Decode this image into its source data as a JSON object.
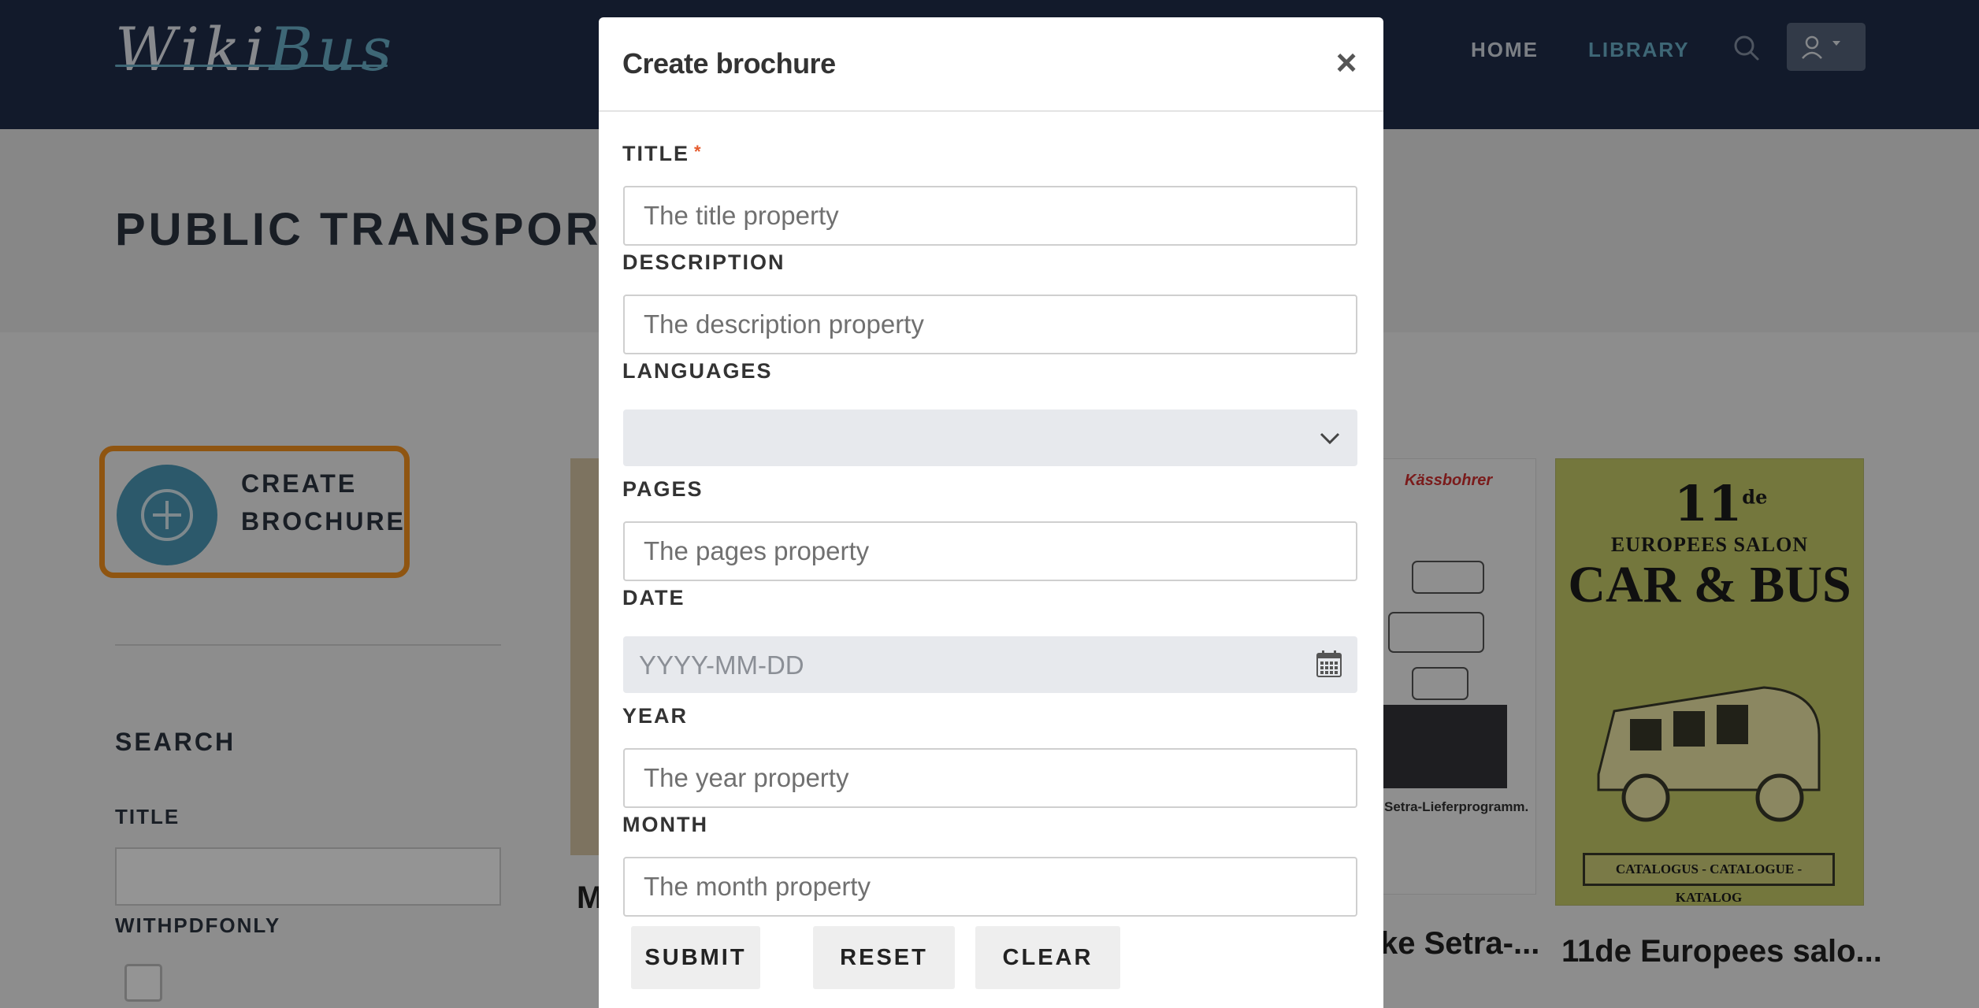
{
  "app": {
    "logo_wiki": "Wiki",
    "logo_bus": "Bus",
    "nav": {
      "home": "HOME",
      "library": "LIBRARY"
    },
    "icons": {
      "search": "search-icon",
      "user": "user-icon",
      "caret": "caret-down-icon"
    }
  },
  "page": {
    "title": "PUBLIC TRANSPORT B",
    "create_button": {
      "line1": "CREATE",
      "line2": "BROCHURE"
    },
    "sidebar": {
      "search_heading": "SEARCH",
      "title_label": "TITLE",
      "title_value": "",
      "withpdfonly_label": "WITHPDFONLY",
      "withpdfonly_checked": false
    },
    "cards": [
      {
        "title": "M"
      },
      {
        "title": "ke Setra-...",
        "brand": "Kässbohrer",
        "caption": "Setra-Lieferprogramm."
      },
      {
        "title": "11de Europees salo...",
        "cover_number": "11",
        "cover_suffix": "de",
        "cover_line1": "EUROPEES SALON",
        "cover_line2": "CAR & BUS",
        "cover_catalog": "CATALOGUS - CATALOGUE - KATALOG"
      }
    ]
  },
  "modal": {
    "title": "Create brochure",
    "close_symbol": "×",
    "fields": {
      "title": {
        "label": "TITLE",
        "required_mark": "*",
        "placeholder": "The title property",
        "value": ""
      },
      "description": {
        "label": "DESCRIPTION",
        "placeholder": "The description property",
        "value": ""
      },
      "languages": {
        "label": "LANGUAGES",
        "selected": ""
      },
      "pages": {
        "label": "PAGES",
        "placeholder": "The pages property",
        "value": ""
      },
      "date": {
        "label": "DATE",
        "placeholder": "YYYY-MM-DD",
        "icon": "calendar-icon"
      },
      "year": {
        "label": "YEAR",
        "placeholder": "The year property",
        "value": ""
      },
      "month": {
        "label": "MONTH",
        "placeholder": "The month property",
        "value": ""
      }
    },
    "buttons": {
      "submit": "SUBMIT",
      "reset": "RESET",
      "clear": "CLEAR"
    }
  },
  "colors": {
    "topbar": "#1f2d4a",
    "accent": "#6bb1cc",
    "highlight": "#f7931e",
    "required": "#e55a2c"
  }
}
